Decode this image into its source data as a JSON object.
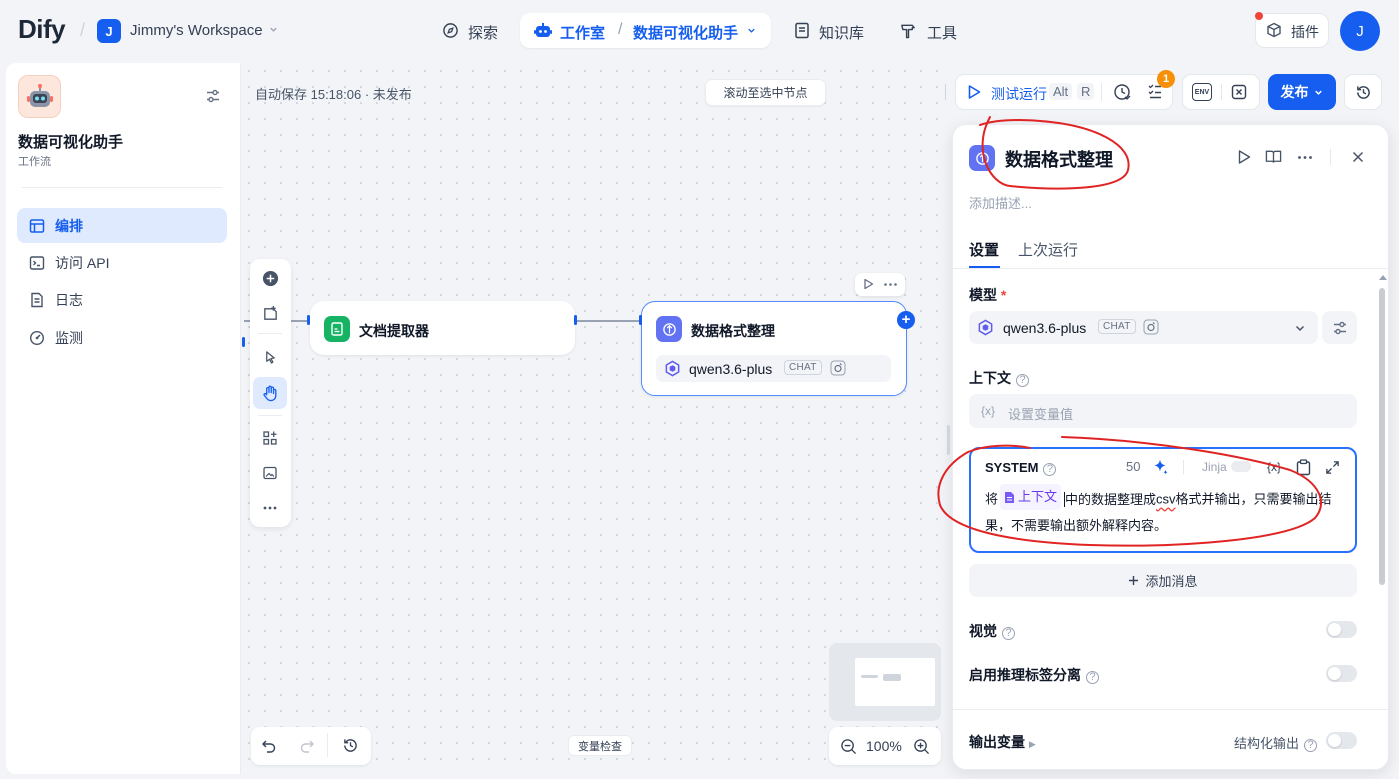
{
  "topbar": {
    "logo": "Dify",
    "workspace_initial": "J",
    "workspace_name": "Jimmy's Workspace",
    "nav": {
      "explore": "探索",
      "studio": "工作室",
      "current_app": "数据可视化助手",
      "knowledge": "知识库",
      "tools": "工具"
    },
    "plugins": "插件",
    "user_initial": "J"
  },
  "sidebar": {
    "app_name": "数据可视化助手",
    "app_type": "工作流",
    "items": [
      {
        "label": "编排",
        "icon": "layout-icon",
        "active": true
      },
      {
        "label": "访问 API",
        "icon": "terminal-icon",
        "active": false
      },
      {
        "label": "日志",
        "icon": "log-icon",
        "active": false
      },
      {
        "label": "监测",
        "icon": "monitor-icon",
        "active": false
      }
    ]
  },
  "canvas": {
    "autosave": "自动保存 15:18:06 · 未发布",
    "scroll_to_node": "滚动至选中节点",
    "nodes": [
      {
        "title": "文档提取器",
        "icon": "document-extractor-icon"
      },
      {
        "title": "数据格式整理",
        "icon": "llm-icon",
        "model": "qwen3.6-plus",
        "model_tag": "CHAT"
      }
    ],
    "zoom": "100%",
    "variable_check": "变量检查"
  },
  "toolbar": {
    "test_run": "测试运行",
    "shortcut_alt": "Alt",
    "shortcut_key": "R",
    "checklist_count": "1",
    "env_label": "ENV",
    "publish": "发布"
  },
  "panel": {
    "title": "数据格式整理",
    "description_placeholder": "添加描述...",
    "tabs": [
      "设置",
      "上次运行"
    ],
    "model_label": "模型",
    "required_mark": "*",
    "model": {
      "name": "qwen3.6-plus",
      "tag": "CHAT"
    },
    "context_label": "上下文",
    "context_var_icon": "{x}",
    "context_placeholder": "设置变量值",
    "system": {
      "label": "SYSTEM",
      "count": "50",
      "jinja": "Jinja",
      "var_icon": "{x}",
      "text_before": "将",
      "context_chip": "上下文",
      "text_mid": "中的数据整理成",
      "csv": "csv",
      "text_after": "格式并输出，只需要输出结果，不需要输出额外解释内容。"
    },
    "add_message": "添加消息",
    "vision_label": "视觉",
    "reasoning_label": "启用推理标签分离",
    "output_vars_label": "输出变量",
    "structured_output": "结构化输出",
    "vision_enabled": false,
    "reasoning_enabled": false,
    "structured_output_enabled": false
  },
  "colors": {
    "primary": "#155eef",
    "llm_node": "#6172f3",
    "extractor_node": "#16b364",
    "annotation": "#e02424",
    "badge": "#f79009"
  }
}
